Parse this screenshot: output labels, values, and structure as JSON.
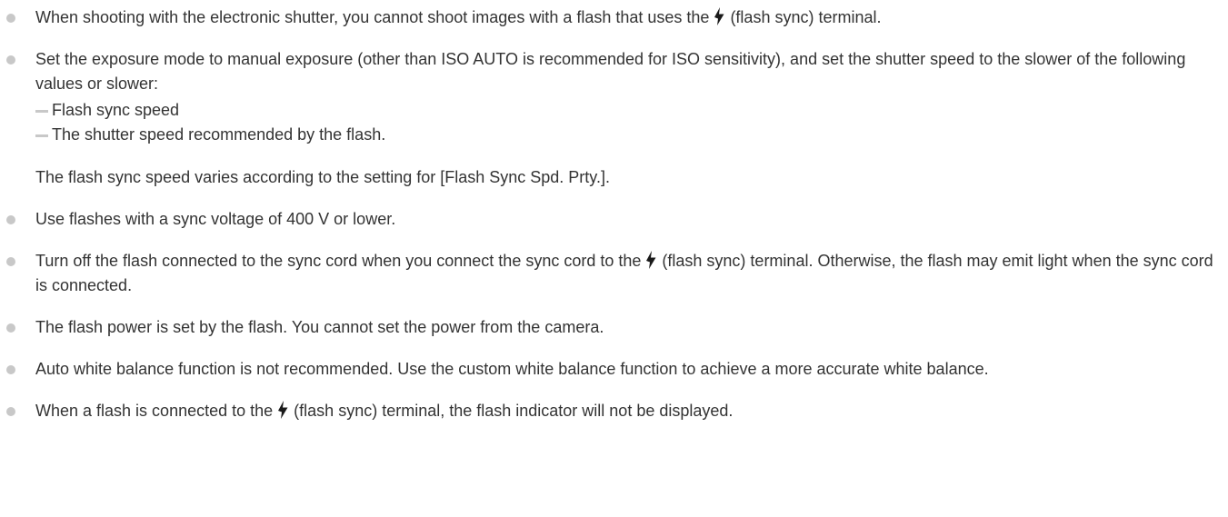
{
  "notes": [
    {
      "before_icon": "When shooting with the electronic shutter, you cannot shoot images with a flash that uses the",
      "after_icon": "(flash sync) terminal."
    },
    {
      "text": "Set the exposure mode to manual exposure (other than ISO AUTO is recommended for ISO sensitivity), and set the shutter speed to the slower of the following values or slower:",
      "subitems": [
        "Flash sync speed",
        "The shutter speed recommended by the flash."
      ],
      "extra": "The flash sync speed varies according to the setting for [Flash Sync Spd. Prty.]."
    },
    {
      "text": "Use flashes with a sync voltage of 400 V or lower."
    },
    {
      "before_icon": "Turn off the flash connected to the sync cord when you connect the sync cord to the",
      "after_icon": "(flash sync) terminal. Otherwise, the flash may emit light when the sync cord is connected."
    },
    {
      "text": "The flash power is set by the flash. You cannot set the power from the camera."
    },
    {
      "text": "Auto white balance function is not recommended. Use the custom white balance function to achieve a more accurate white balance."
    },
    {
      "before_icon": "When a flash is connected to the",
      "after_icon": "(flash sync) terminal, the flash indicator will not be displayed."
    }
  ],
  "icons": {
    "bullet": "bullet-dot-icon",
    "dash": "dash-icon",
    "flash": "flash-sync-icon"
  },
  "colors": {
    "text": "#333333",
    "bullet": "#c8c8c8",
    "icon": "#1a1a1a"
  }
}
